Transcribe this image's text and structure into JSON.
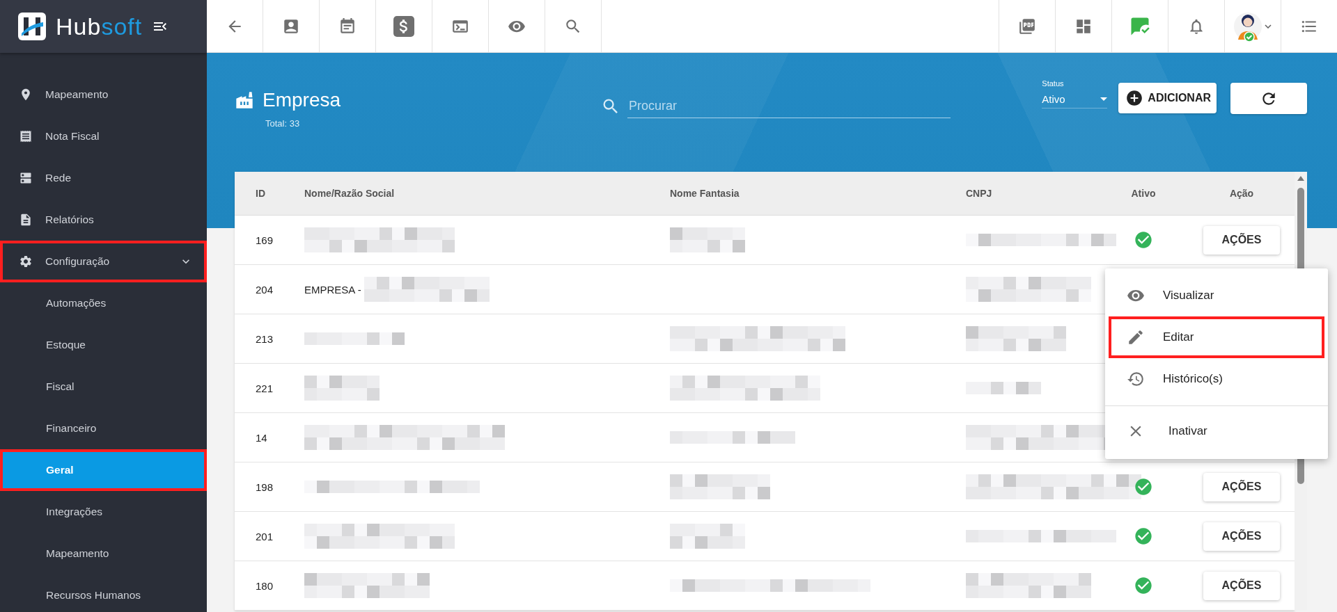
{
  "logo": {
    "text": "Hub",
    "accent": "soft"
  },
  "sidebar": {
    "items": [
      {
        "label": "Mapeamento",
        "selected": false,
        "highlighted": false
      },
      {
        "label": "Nota Fiscal",
        "selected": false,
        "highlighted": false
      },
      {
        "label": "Rede",
        "selected": false,
        "highlighted": false
      },
      {
        "label": "Relatórios",
        "selected": false,
        "highlighted": false
      },
      {
        "label": "Configuração",
        "selected": false,
        "highlighted": true,
        "expanded": true,
        "children": [
          {
            "label": "Automações",
            "selected": false,
            "highlighted": false
          },
          {
            "label": "Estoque",
            "selected": false,
            "highlighted": false
          },
          {
            "label": "Fiscal",
            "selected": false,
            "highlighted": false
          },
          {
            "label": "Financeiro",
            "selected": false,
            "highlighted": false
          },
          {
            "label": "Geral",
            "selected": true,
            "highlighted": true
          },
          {
            "label": "Integrações",
            "selected": false,
            "highlighted": false
          },
          {
            "label": "Mapeamento",
            "selected": false,
            "highlighted": false
          },
          {
            "label": "Recursos Humanos",
            "selected": false,
            "highlighted": false
          }
        ]
      }
    ]
  },
  "page": {
    "title": "Empresa",
    "total": "Total: 33"
  },
  "search": {
    "placeholder": "Procurar"
  },
  "status_filter": {
    "label": "Status",
    "value": "Ativo"
  },
  "add_button": "ADICIONAR",
  "table": {
    "columns": [
      "ID",
      "Nome/Razão Social",
      "Nome Fantasia",
      "CNPJ",
      "Ativo",
      "Ação"
    ],
    "rows": [
      {
        "id": "169",
        "name": {
          "kind": "blurred"
        },
        "trade_name": {
          "kind": "blurred"
        },
        "cnpj": {
          "kind": "blurred"
        },
        "active": true,
        "action": "AÇÕES"
      },
      {
        "id": "204",
        "name": {
          "kind": "partial",
          "text": "EMPRESA -"
        },
        "cnpj": {
          "kind": "blurred"
        }
      },
      {
        "id": "213",
        "name": {
          "kind": "blurred"
        },
        "trade_name": {
          "kind": "blurred"
        },
        "cnpj": {
          "kind": "blurred"
        }
      },
      {
        "id": "221",
        "name": {
          "kind": "blurred"
        },
        "trade_name": {
          "kind": "blurred"
        },
        "cnpj": {
          "kind": "blurred"
        }
      },
      {
        "id": "14",
        "name": {
          "kind": "blurred"
        },
        "trade_name": {
          "kind": "blurred"
        },
        "cnpj": {
          "kind": "blurred"
        }
      },
      {
        "id": "198",
        "name": {
          "kind": "blurred"
        },
        "trade_name": {
          "kind": "blurred"
        },
        "cnpj": {
          "kind": "blurred"
        },
        "active": true,
        "action": "AÇÕES"
      },
      {
        "id": "201",
        "name": {
          "kind": "blurred"
        },
        "trade_name": {
          "kind": "blurred"
        },
        "cnpj": {
          "kind": "blurred"
        },
        "active": true,
        "action": "AÇÕES"
      },
      {
        "id": "180",
        "name": {
          "kind": "blurred"
        },
        "trade_name": {
          "kind": "blurred"
        },
        "cnpj": {
          "kind": "blurred"
        },
        "active": true,
        "action": "AÇÕES"
      }
    ]
  },
  "action_menu": {
    "items": [
      {
        "label": "Visualizar",
        "highlighted": false
      },
      {
        "label": "Editar",
        "highlighted": true
      },
      {
        "label": "Histórico(s)",
        "highlighted": false
      },
      {
        "label": "Inativar",
        "highlighted": false
      }
    ]
  }
}
